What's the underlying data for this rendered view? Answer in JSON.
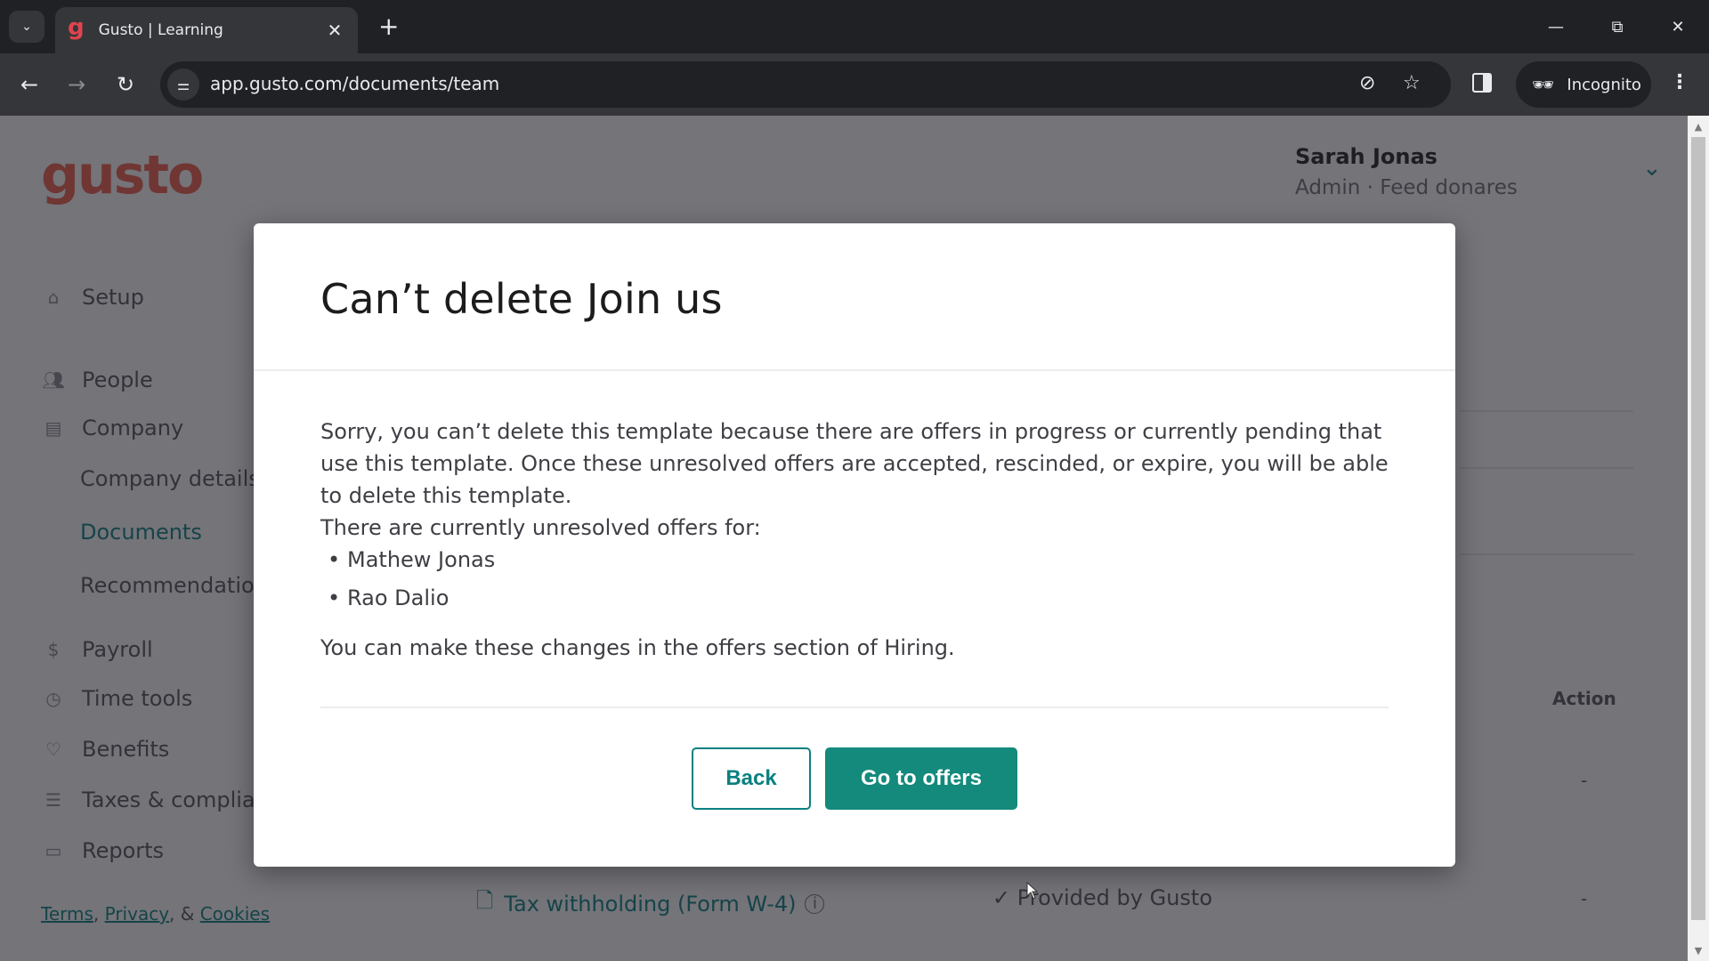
{
  "browser": {
    "tab_title": "Gusto | Learning",
    "tab_favicon": "g",
    "url": "app.gusto.com/documents/team",
    "incognito_label": "Incognito",
    "icons": {
      "tab_search": "chevron-down-icon",
      "tab_close": "close-icon",
      "new_tab": "plus-icon",
      "back": "arrow-left-icon",
      "forward": "arrow-right-icon",
      "reload": "reload-icon",
      "site_info": "tune-icon",
      "tracking": "eye-off-icon",
      "bookmark": "star-icon",
      "side_panel": "side-panel-icon",
      "incognito": "incognito-icon",
      "menu": "kebab-menu-icon",
      "minimize": "minimize-icon",
      "restore": "restore-icon",
      "close_window": "close-icon"
    }
  },
  "app": {
    "logo": "gusto",
    "user": {
      "name": "Sarah Jonas",
      "role": "Admin · Feed donares"
    },
    "sidebar": {
      "items": [
        {
          "label": "Setup",
          "icon": "home-icon"
        },
        {
          "label": "People",
          "icon": "people-icon"
        },
        {
          "label": "Company",
          "icon": "building-icon"
        },
        {
          "label": "Company details",
          "sub": true
        },
        {
          "label": "Documents",
          "sub": true,
          "active": true
        },
        {
          "label": "Recommendations",
          "sub": true
        },
        {
          "label": "Payroll",
          "icon": "dollar-icon"
        },
        {
          "label": "Time tools",
          "icon": "clock-icon"
        },
        {
          "label": "Benefits",
          "icon": "heart-icon"
        },
        {
          "label": "Taxes & compliance",
          "icon": "list-icon"
        },
        {
          "label": "Reports",
          "icon": "report-icon"
        }
      ]
    },
    "footer": {
      "terms": "Terms",
      "sep1": ", ",
      "privacy": "Privacy",
      "sep2": ", & ",
      "cookies": "Cookies"
    },
    "background_table": {
      "action_header": "Action",
      "row_dash": "-",
      "doc_row": {
        "name": "Tax withholding (Form W-4)",
        "status": "✓ Provided by Gusto",
        "action": "-"
      }
    }
  },
  "modal": {
    "title": "Can’t delete Join us",
    "message": "Sorry, you can’t delete this template because there are offers in progress or currently pending that use this template. Once these unresolved offers are accepted, rescinded, or expire, you will be able to delete this template.",
    "list_intro": "There are currently unresolved offers for:",
    "offers": [
      "Mathew Jonas",
      "Rao Dalio"
    ],
    "hiring_note": "You can make these changes in the offers section of Hiring.",
    "back_label": "Back",
    "primary_label": "Go to offers"
  },
  "colors": {
    "brand": "#f45d48",
    "accent": "#138a7c",
    "link": "#0a8080"
  }
}
